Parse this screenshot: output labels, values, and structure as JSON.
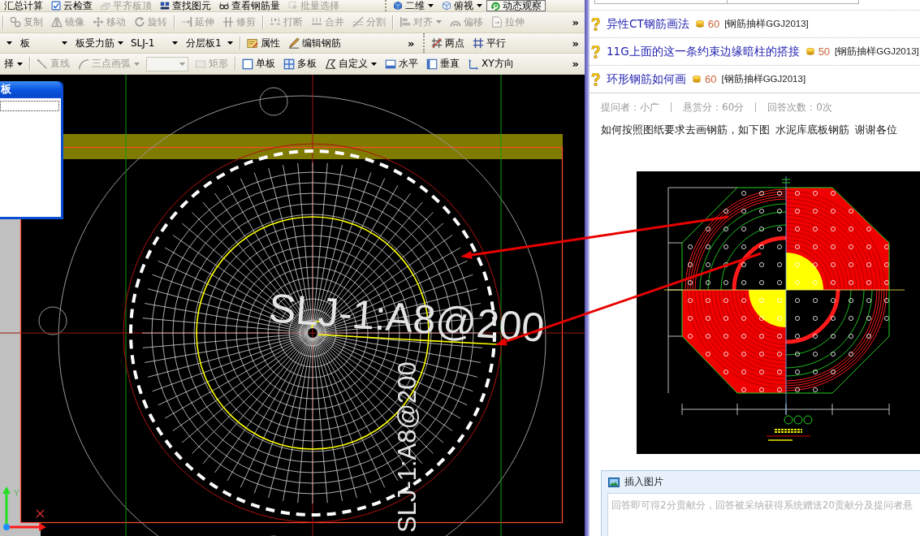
{
  "cad": {
    "toolbar_rows": [
      {
        "toolbars": [
          {
            "items": [
              {
                "kind": "button",
                "label": "汇总计算",
                "disabled": false
              },
              {
                "kind": "button",
                "label": "云检查",
                "disabled": false
              },
              {
                "kind": "button",
                "label": "平齐板顶",
                "disabled": true
              },
              {
                "kind": "button",
                "label": "查找图元",
                "disabled": false
              },
              {
                "kind": "button",
                "label": "查看钢筋量",
                "disabled": false
              },
              {
                "kind": "button",
                "label": "批量选择",
                "disabled": true
              }
            ]
          },
          {
            "items": [
              {
                "kind": "menu-button",
                "label": "二维",
                "disabled": false
              },
              {
                "kind": "menu-button",
                "label": "俯视",
                "disabled": false
              },
              {
                "kind": "framed-button",
                "label": "动态观察",
                "disabled": false
              }
            ]
          }
        ]
      },
      {
        "toolbars": [
          {
            "items": [
              {
                "kind": "separator"
              },
              {
                "kind": "button",
                "label": "复制",
                "disabled": true
              },
              {
                "kind": "button",
                "label": "镜像",
                "disabled": true
              },
              {
                "kind": "button",
                "label": "移动",
                "disabled": true
              },
              {
                "kind": "button",
                "label": "旋转",
                "disabled": true
              },
              {
                "kind": "separator"
              },
              {
                "kind": "button",
                "label": "延伸",
                "disabled": true
              },
              {
                "kind": "button",
                "label": "修剪",
                "disabled": true
              },
              {
                "kind": "separator"
              },
              {
                "kind": "button",
                "label": "打断",
                "disabled": true
              },
              {
                "kind": "button",
                "label": "合并",
                "disabled": true
              },
              {
                "kind": "button",
                "label": "分割",
                "disabled": true
              },
              {
                "kind": "separator"
              },
              {
                "kind": "menu-button",
                "label": "对齐",
                "disabled": true
              },
              {
                "kind": "button",
                "label": "偏移",
                "disabled": true
              },
              {
                "kind": "button",
                "label": "拉伸",
                "disabled": true
              }
            ],
            "overflow": "»"
          }
        ]
      },
      {
        "toolbars": [
          {
            "items": [
              {
                "kind": "dropdown",
                "disabled": false
              },
              {
                "kind": "dropdown",
                "label": "板",
                "disabled": false
              },
              {
                "kind": "dropdown",
                "label": "板受力筋",
                "disabled": false
              },
              {
                "kind": "dropdown",
                "label": "SLJ-1",
                "disabled": false
              },
              {
                "kind": "dropdown",
                "label": "分层板1",
                "disabled": false
              },
              {
                "kind": "separator"
              },
              {
                "kind": "button",
                "label": "属性",
                "disabled": false
              },
              {
                "kind": "button",
                "label": "编辑钢筋",
                "disabled": false
              }
            ],
            "overflow": "»"
          },
          {
            "items": [
              {
                "kind": "button",
                "label": "两点",
                "disabled": false
              },
              {
                "kind": "button",
                "label": "平行",
                "disabled": false
              }
            ],
            "overflow": "»"
          }
        ]
      },
      {
        "toolbars": [
          {
            "items": [
              {
                "kind": "menu-button",
                "label": "择",
                "disabled": false
              },
              {
                "kind": "separator"
              },
              {
                "kind": "button",
                "label": "直线",
                "disabled": true
              },
              {
                "kind": "menu-button",
                "label": "三点画弧",
                "disabled": true
              },
              {
                "kind": "combo",
                "disabled": true
              },
              {
                "kind": "button",
                "label": "矩形",
                "disabled": true
              },
              {
                "kind": "separator"
              },
              {
                "kind": "button",
                "label": "单板",
                "disabled": false
              },
              {
                "kind": "button",
                "label": "多板",
                "disabled": false
              },
              {
                "kind": "menu-button",
                "label": "自定义",
                "disabled": false
              },
              {
                "kind": "button",
                "label": "水平",
                "disabled": false
              },
              {
                "kind": "button",
                "label": "垂直",
                "disabled": false
              },
              {
                "kind": "button",
                "label": "XY方向",
                "disabled": false
              }
            ],
            "overflow": "»"
          }
        ]
      }
    ],
    "floating_panel": {
      "title": "板"
    },
    "canvas": {
      "horizontal_label": "SLJ-1:A8@200",
      "vertical_label": "SLJ-1:A8@200",
      "axis_label": "Y"
    }
  },
  "qa": {
    "related": [
      {
        "title": "异性CT钢筋画法",
        "points": "60",
        "tag": "[钢筋抽样GGJ2013]"
      },
      {
        "title": "11G上面的这一条约束边缘暗柱的搭接",
        "points": "50",
        "tag": "[钢筋抽样GGJ2013]"
      },
      {
        "title": "环形钢筋如何画",
        "points": "60",
        "tag": "[钢筋抽样GGJ2013]"
      }
    ],
    "meta": [
      "提问者：小广",
      "悬赏分：60分",
      "回答次数：0次"
    ],
    "question": "如何按照图纸要求去画钢筋，如下图 水泥库底板钢筋 谢谢各位",
    "answer_box": {
      "button": "插入图片",
      "placeholder": "回答即可得2分贡献分，回答被采纳获得系统赠送20贡献分及提问者悬"
    }
  }
}
